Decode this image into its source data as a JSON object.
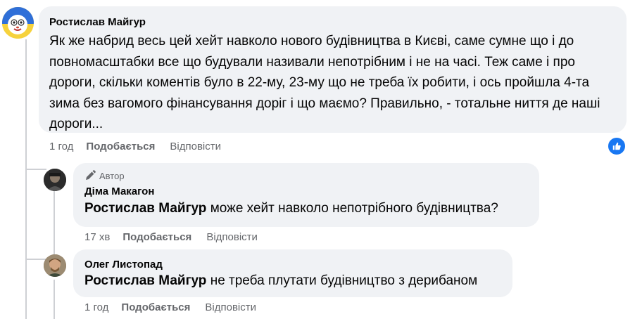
{
  "comments": [
    {
      "author": "Ростислав Майгур",
      "text": "Як же набрид весь цей хейт навколо нового будівництва в Києві, саме сумне що і до повномасштабки все що будували називали непотрібним і не на часі. Теж саме і про дороги, скільки коментів було в 22-му, 23-му що не треба їх робити, і ось пройшла 4-та зима без вагомого фінансування доріг і що маємо? Правильно, - тотальне ниття де наші дороги...",
      "time": "1 год",
      "like_label": "Подобається",
      "reply_label": "Відповісти",
      "reaction_color": "#1877f2"
    }
  ],
  "replies": [
    {
      "badge": "Автор",
      "author": "Діма Макагон",
      "mention": "Ростислав Майгур",
      "text": " може хейт навколо непотрібного будівництва?",
      "time": "17 хв",
      "like_label": "Подобається",
      "reply_label": "Відповісти"
    },
    {
      "author": "Олег Листопад",
      "mention": "Ростислав Майгур",
      "text": " не треба плутати будівництво з дерибаном",
      "time": "1 год",
      "like_label": "Подобається",
      "reply_label": "Відповісти"
    }
  ],
  "colors": {
    "bubble": "#f0f2f5",
    "meta_text": "#65676b",
    "thread_line": "#ced0d4",
    "like_blue": "#1877f2"
  },
  "icons": {
    "reaction": "like-thumb-icon",
    "author_badge": "pencil-icon"
  }
}
